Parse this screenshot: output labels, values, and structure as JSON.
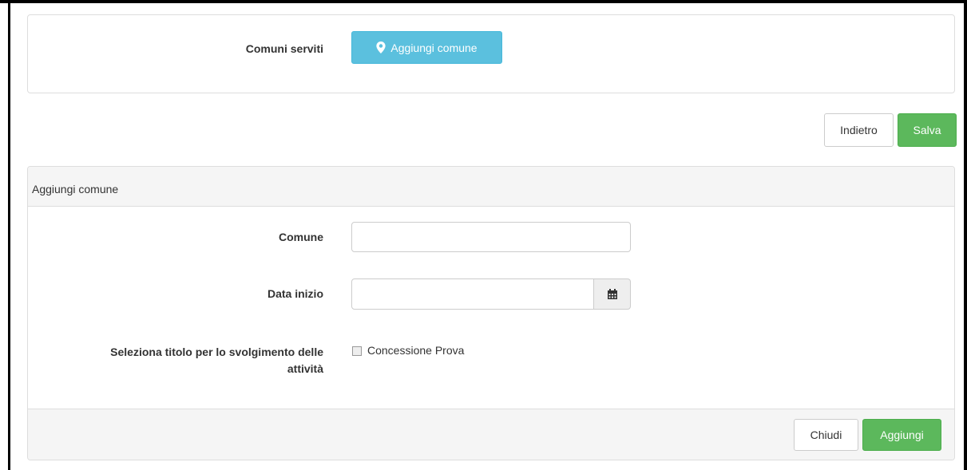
{
  "top_panel": {
    "comuni_label": "Comuni serviti",
    "add_button_label": "Aggiungi comune",
    "add_button_icon": "map-marker-icon"
  },
  "actions": {
    "back_label": "Indietro",
    "save_label": "Salva"
  },
  "modal": {
    "heading": "Aggiungi comune",
    "comune_label": "Comune",
    "comune_value": "",
    "data_inizio_label": "Data inizio",
    "data_inizio_value": "",
    "calendar_icon": "calendar-icon",
    "titolo_label_line1": "Seleziona titolo per lo svolgimento delle",
    "titolo_label_line2": "attività",
    "checkbox_label": "Concessione Prova",
    "close_label": "Chiudi",
    "add_label": "Aggiungi"
  },
  "colors": {
    "info": "#5bc0de",
    "success": "#5cb85c",
    "panel_bg": "#f5f5f5",
    "border": "#dddddd"
  }
}
